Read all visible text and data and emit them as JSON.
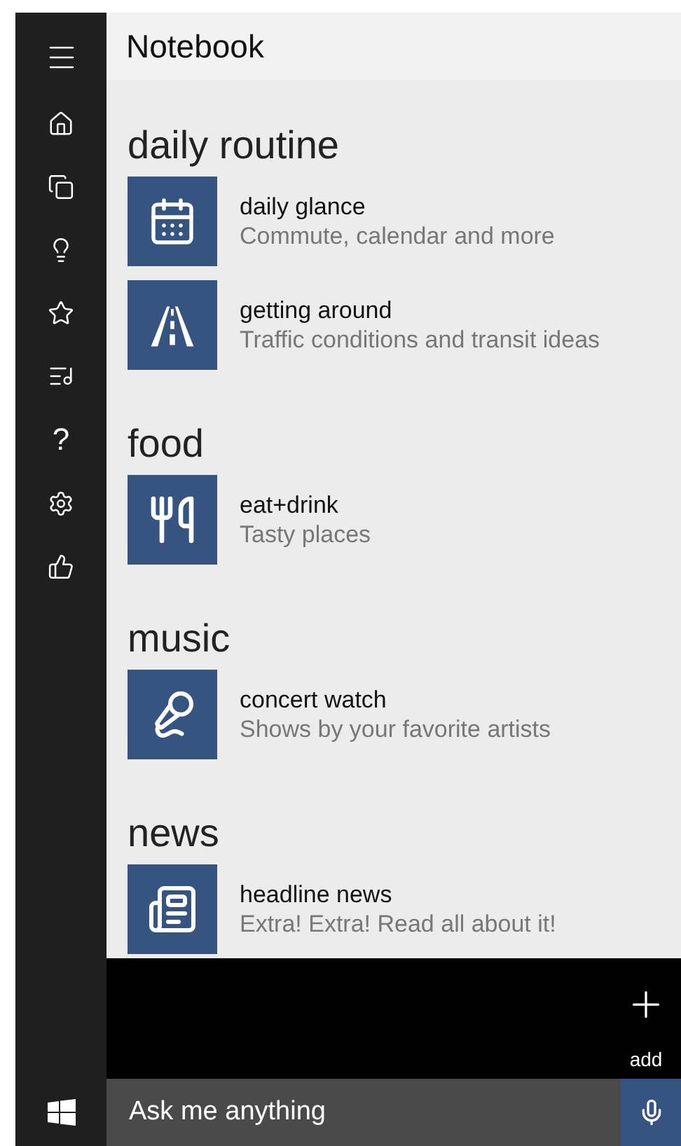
{
  "header": {
    "title": "Notebook"
  },
  "sidebar": {
    "help_glyph": "?"
  },
  "sections": [
    {
      "title": "daily routine",
      "items": [
        {
          "kind": "calendar",
          "title": "daily glance",
          "subtitle": "Commute, calendar and more"
        },
        {
          "kind": "road",
          "title": "getting around",
          "subtitle": "Traffic conditions and transit ideas"
        }
      ]
    },
    {
      "title": "food",
      "items": [
        {
          "kind": "food",
          "title": "eat+drink",
          "subtitle": "Tasty places"
        }
      ]
    },
    {
      "title": "music",
      "items": [
        {
          "kind": "microphone",
          "title": "concert watch",
          "subtitle": "Shows by your favorite artists"
        }
      ]
    },
    {
      "title": "news",
      "items": [
        {
          "kind": "newspaper",
          "title": "headline news",
          "subtitle": "Extra! Extra! Read all about it!"
        }
      ]
    }
  ],
  "add_button": {
    "label": "add"
  },
  "search": {
    "placeholder": "Ask me anything"
  }
}
